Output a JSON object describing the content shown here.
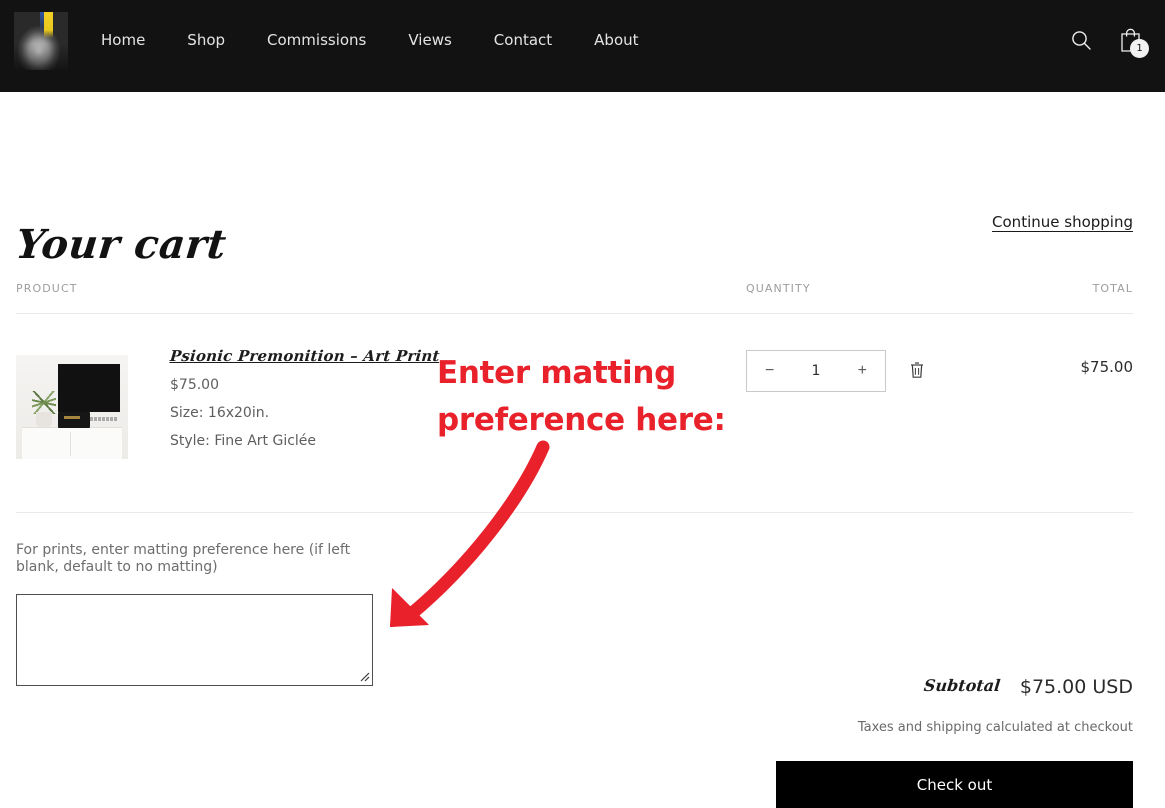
{
  "header": {
    "logo_alt": "artist-portrait-logo",
    "nav": [
      {
        "label": "Home"
      },
      {
        "label": "Shop"
      },
      {
        "label": "Commissions"
      },
      {
        "label": "Views"
      },
      {
        "label": "Contact"
      },
      {
        "label": "About"
      }
    ],
    "search_icon": "search-icon",
    "cart_icon": "shopping-bag-icon",
    "cart_count": "1"
  },
  "cart": {
    "title": "Your cart",
    "continue_shopping": "Continue shopping",
    "columns": {
      "product": "PRODUCT",
      "quantity": "QUANTITY",
      "total": "TOTAL"
    },
    "item": {
      "thumbnail_alt": "framed-art-print-in-room-mockup",
      "title": "Psionic Premonition – Art Print",
      "price": "$75.00",
      "size": "Size: 16x20in.",
      "style": "Style: Fine Art Giclée",
      "qty_decrement": "−",
      "qty_value": "1",
      "qty_increment": "+",
      "remove_icon": "trash-icon",
      "line_total": "$75.00"
    },
    "note": {
      "label": "For prints, enter matting preference here (if left blank, default to no matting)",
      "value": "",
      "placeholder": ""
    },
    "summary": {
      "subtotal_label": "Subtotal",
      "subtotal_value": "$75.00 USD",
      "tax_note": "Taxes and shipping calculated at checkout",
      "checkout_label": "Check out"
    }
  },
  "annotation": {
    "text": "Enter matting\npreference here:",
    "arrow": "curved-arrow-down-left",
    "color": "#e8212b"
  }
}
